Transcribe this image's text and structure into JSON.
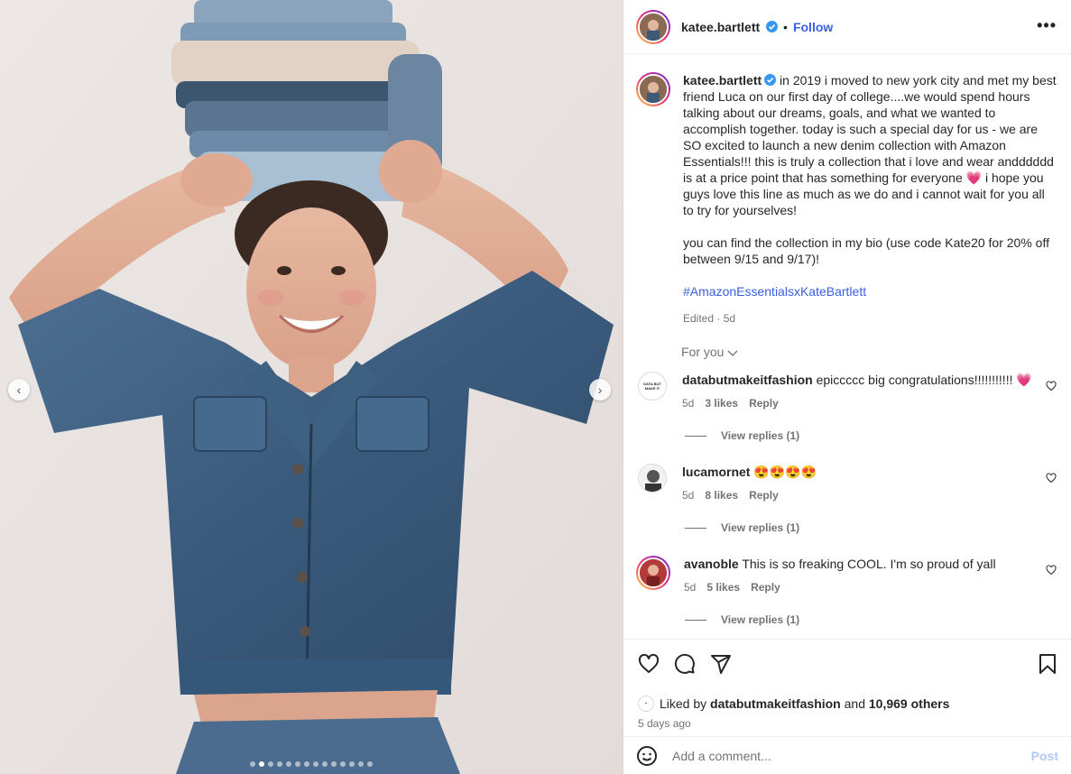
{
  "post": {
    "author": "katee.bartlett",
    "follow_label": "Follow",
    "separator": "•",
    "more_label": "•••",
    "caption": {
      "paragraph1_a": "in 2019 i moved to new york city and met my best friend Luca on our first day of college....we would spend hours talking about our dreams, goals, and what we wanted to accomplish together. today is such a special day for us - we are SO excited to launch a new denim collection with Amazon Essentials!!! this is truly a collection that i love and wear andddddd is at a price point that has something for everyone",
      "paragraph1_b": "i hope you guys love this line as much as we do and i cannot wait for you all to try for yourselves!",
      "paragraph2": "you can find the collection in my bio (use code Kate20 for 20% off between 9/15 and 9/17)!",
      "hashtag": "#AmazonEssentialsxKateBartlett",
      "meta": "Edited · 5d"
    },
    "for_you_label": "For you"
  },
  "comments": [
    {
      "user": "databutmakeitfashion",
      "text": "epiccccc big congratulations!!!!!!!!!!!",
      "emoji": "💗",
      "age": "5d",
      "likes": "3 likes",
      "reply_label": "Reply",
      "view_replies": "View replies (1)",
      "avatar_text": "DATA BUT MAKE IT"
    },
    {
      "user": "lucamornet",
      "text": "",
      "emoji": "😍😍😍😍",
      "age": "5d",
      "likes": "8 likes",
      "reply_label": "Reply",
      "view_replies": "View replies (1)"
    },
    {
      "user": "avanoble",
      "text": "This is so freaking COOL. I'm so proud of yall",
      "emoji": "",
      "age": "5d",
      "likes": "5 likes",
      "reply_label": "Reply",
      "view_replies": "View replies (1)"
    }
  ],
  "engagement": {
    "liked_prefix": "Liked by",
    "liked_user": "databutmakeitfashion",
    "liked_and": "and",
    "liked_others": "10,969 others",
    "time": "5 days ago"
  },
  "add_comment": {
    "placeholder": "Add a comment...",
    "post_label": "Post"
  },
  "carousel": {
    "prev_label": "‹",
    "next_label": "›",
    "slide_count": 14,
    "active_index": 1
  },
  "colors": {
    "accent": "#3a5fe0",
    "verified": "#3897f0",
    "post_disabled": "#b2c9f9"
  }
}
